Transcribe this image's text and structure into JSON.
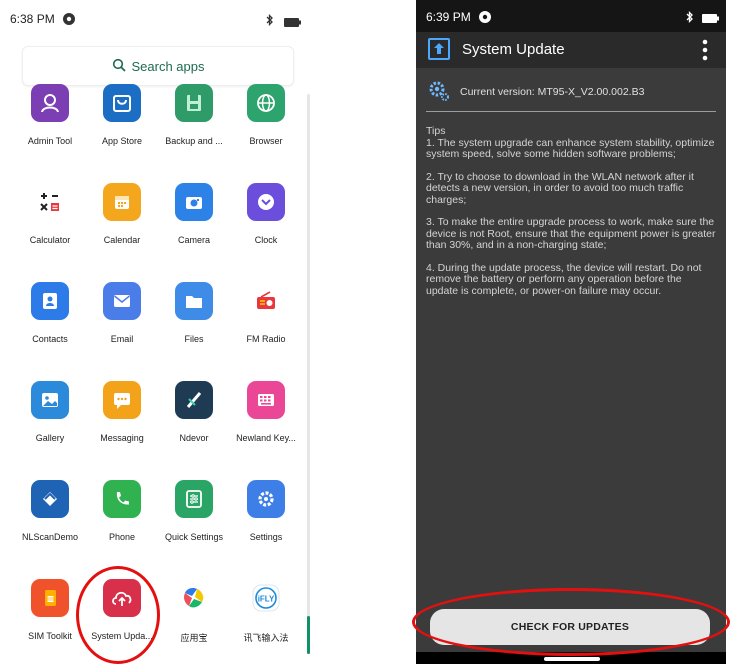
{
  "left": {
    "status": {
      "time": "6:38 PM"
    },
    "search": {
      "label": "Search apps"
    },
    "apps": [
      {
        "label": "Admin Tool",
        "icon": "admin-tool-icon",
        "color": "#7b3fb3"
      },
      {
        "label": "App Store",
        "icon": "app-store-icon",
        "color": "#1c6ec4"
      },
      {
        "label": "Backup and ...",
        "icon": "backup-icon",
        "color": "#2f9b68"
      },
      {
        "label": "Browser",
        "icon": "browser-icon",
        "color": "#2da36d"
      },
      {
        "label": "Calculator",
        "icon": "calculator-icon",
        "color": "#ffffff"
      },
      {
        "label": "Calendar",
        "icon": "calendar-icon",
        "color": "#f4a71c"
      },
      {
        "label": "Camera",
        "icon": "camera-icon",
        "color": "#2d82e8"
      },
      {
        "label": "Clock",
        "icon": "clock-icon",
        "color": "#6b4fdc"
      },
      {
        "label": "Contacts",
        "icon": "contacts-icon",
        "color": "#2d7be8"
      },
      {
        "label": "Email",
        "icon": "email-icon",
        "color": "#4b7de9"
      },
      {
        "label": "Files",
        "icon": "files-icon",
        "color": "#3e8be8"
      },
      {
        "label": "FM Radio",
        "icon": "fm-radio-icon",
        "color": "#ffffff"
      },
      {
        "label": "Gallery",
        "icon": "gallery-icon",
        "color": "#2b8ad9"
      },
      {
        "label": "Messaging",
        "icon": "messaging-icon",
        "color": "#f2a31a"
      },
      {
        "label": "Ndevor",
        "icon": "ndevor-icon",
        "color": "#1f3b53"
      },
      {
        "label": "Newland Key...",
        "icon": "keyboard-icon",
        "color": "#ea4797"
      },
      {
        "label": "NLScanDemo",
        "icon": "nlscan-icon",
        "color": "#1f63b5"
      },
      {
        "label": "Phone",
        "icon": "phone-icon",
        "color": "#2fb24f"
      },
      {
        "label": "Quick Settings",
        "icon": "quick-settings-icon",
        "color": "#2aa566"
      },
      {
        "label": "Settings",
        "icon": "settings-gear-icon",
        "color": "#3d7fe6"
      },
      {
        "label": "SIM Toolkit",
        "icon": "sim-toolkit-icon",
        "color": "#f0532b"
      },
      {
        "label": "System Upda...",
        "icon": "system-update-icon",
        "color": "#d8304b"
      },
      {
        "label": "应用宝",
        "icon": "yingyongbao-icon",
        "color": "#ffffff"
      },
      {
        "label": "讯飞输入法",
        "icon": "ifly-icon",
        "color": "#ffffff"
      }
    ]
  },
  "right": {
    "status": {
      "time": "6:39 PM"
    },
    "title": "System Update",
    "current_version": "Current version: MT95-X_V2.00.002.B3",
    "tips": [
      "Tips\n1. The system upgrade can enhance system stability, optimize system speed, solve some hidden software problems;",
      "2. Try to choose to download in the WLAN network after it detects a new version, in order to avoid too much traffic charges;",
      "3. To make the entire upgrade process to work, make sure the device is not Root, ensure that the equipment power is greater than 30%, and in a non-charging state;",
      "4. During the update process, the device will restart. Do not remove the battery or perform any operation before the update is complete, or power-on failure may occur."
    ],
    "check_button": "CHECK FOR UPDATES"
  },
  "colors": {
    "highlight": "#e41010",
    "accent": "#129167"
  }
}
